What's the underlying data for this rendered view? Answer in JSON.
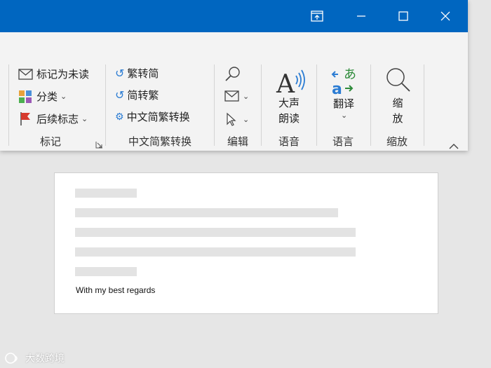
{
  "ribbon": {
    "tag": {
      "mark_unread": "标记为未读",
      "categorize": "分类",
      "follow_up": "后续标志",
      "group_label": "标记"
    },
    "convert": {
      "trad_to_simp": "繁转简",
      "simp_to_trad": "简转繁",
      "chinese_convert": "中文简繁转换",
      "group_label": "中文简繁转换"
    },
    "edit": {
      "group_label": "编辑"
    },
    "speech": {
      "read_aloud_line1": "大声",
      "read_aloud_line2": "朗读",
      "group_label": "语音"
    },
    "language": {
      "translate": "翻译",
      "group_label": "语言"
    },
    "zoom": {
      "zoom_line1": "缩",
      "zoom_line2": "放",
      "group_label": "缩放"
    }
  },
  "document": {
    "signature": "With my best regards"
  },
  "watermark": {
    "text": "大数跨境"
  },
  "colors": {
    "titlebar": "#0066c0",
    "accent": "#2b7cd3"
  }
}
